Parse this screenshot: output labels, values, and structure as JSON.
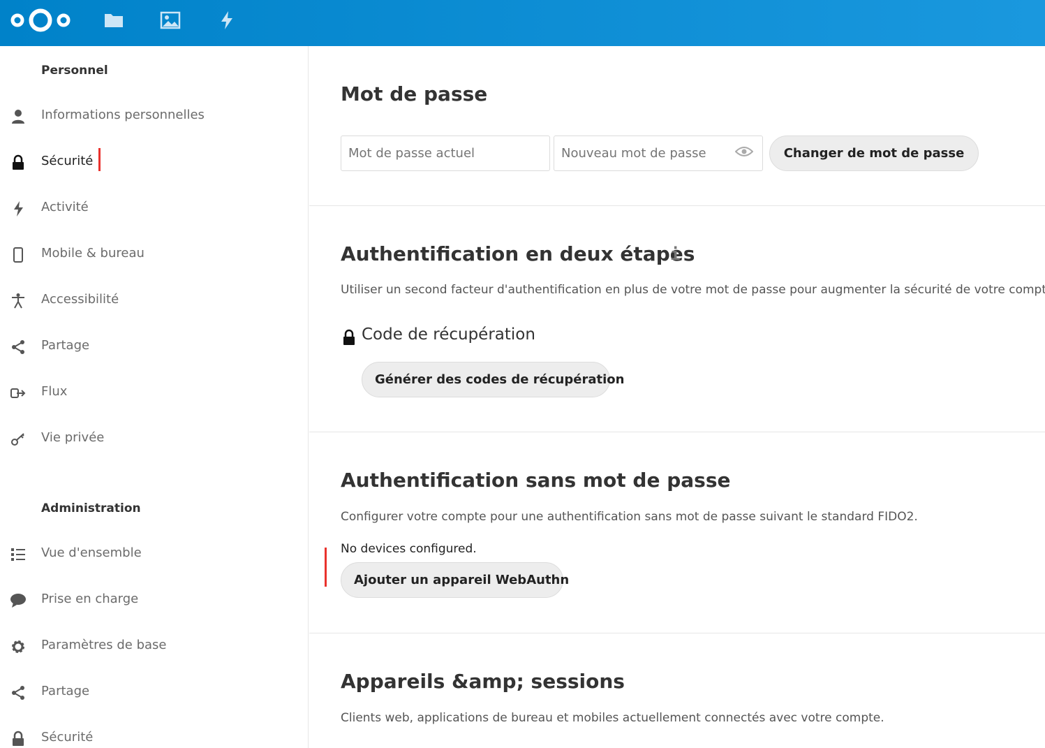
{
  "header": {
    "logo": "nextcloud-logo",
    "apps": [
      {
        "name": "files-icon"
      },
      {
        "name": "photos-icon"
      },
      {
        "name": "activity-icon"
      }
    ]
  },
  "sidebar": {
    "personal_heading": "Personnel",
    "personal_items": [
      {
        "label": "Informations personnelles",
        "icon": "user-icon"
      },
      {
        "label": "Sécurité",
        "icon": "lock-icon",
        "active": true
      },
      {
        "label": "Activité",
        "icon": "lightning-icon"
      },
      {
        "label": "Mobile & bureau",
        "icon": "phone-icon"
      },
      {
        "label": "Accessibilité",
        "icon": "accessibility-icon"
      },
      {
        "label": "Partage",
        "icon": "share-icon"
      },
      {
        "label": "Flux",
        "icon": "flux-icon"
      },
      {
        "label": "Vie privée",
        "icon": "key-icon"
      }
    ],
    "admin_heading": "Administration",
    "admin_items": [
      {
        "label": "Vue d'ensemble",
        "icon": "list-icon"
      },
      {
        "label": "Prise en charge",
        "icon": "chat-bubble-icon"
      },
      {
        "label": "Paramètres de base",
        "icon": "gear-icon"
      },
      {
        "label": "Partage",
        "icon": "share-icon"
      },
      {
        "label": "Sécurité",
        "icon": "lock-icon"
      }
    ]
  },
  "password": {
    "title": "Mot de passe",
    "current_placeholder": "Mot de passe actuel",
    "new_placeholder": "Nouveau mot de passe",
    "change_button": "Changer de mot de passe"
  },
  "twofactor": {
    "title": "Authentification en deux étapes",
    "info": "i",
    "description": "Utiliser un second facteur d'authentification en plus de votre mot de passe pour augmenter la sécurité de votre compte.",
    "recovery_title": "Code de récupération",
    "recovery_button": "Générer des codes de récupération"
  },
  "passwordless": {
    "title": "Authentification sans mot de passe",
    "description": "Configurer votre compte pour une authentification sans mot de passe suivant le standard FIDO2.",
    "no_devices": "No devices configured.",
    "add_button": "Ajouter un appareil WebAuthn"
  },
  "sessions": {
    "title": "Appareils &amp; sessions",
    "description": "Clients web, applications de bureau et mobiles actuellement connectés avec votre compte."
  },
  "colors": {
    "header_start": "#0082c9",
    "header_end": "#1a98de",
    "active_marker": "#e9322d"
  }
}
